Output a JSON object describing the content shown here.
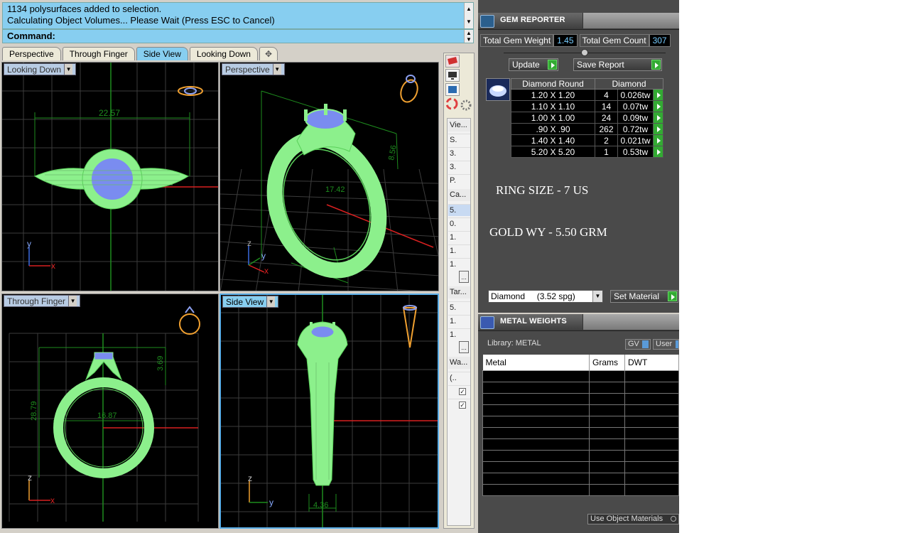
{
  "command": {
    "history_line1": "1134 polysurfaces added to selection.",
    "history_line2": "Calculating Object Volumes... Please Wait (Press ESC to Cancel)",
    "prompt": "Command:"
  },
  "tabs": [
    {
      "label": "Perspective"
    },
    {
      "label": "Through Finger"
    },
    {
      "label": "Side View"
    },
    {
      "label": "Looking Down"
    }
  ],
  "viewports": {
    "top_left": {
      "label": "Looking Down",
      "dimension": "22.57",
      "axis_x": "x",
      "axis_y": "y"
    },
    "top_right": {
      "label": "Perspective",
      "dimension_a": "17.42",
      "dimension_b": "8.56",
      "axis_x": "x",
      "axis_y": "y",
      "axis_z": "z"
    },
    "bottom_left": {
      "label": "Through Finger",
      "dimension_a": "16.87",
      "dimension_b": "28.79",
      "dimension_c": "3.69",
      "axis_x": "x",
      "axis_z": "z"
    },
    "bottom_right": {
      "label": "Side View",
      "dimension": "4.36",
      "axis_y": "y",
      "axis_z": "z"
    }
  },
  "side_panel": {
    "section1": "Vie...",
    "rows1": [
      "S.",
      "3.",
      "3.",
      "P."
    ],
    "section2": "Ca...",
    "rows2": [
      "5.",
      "0.",
      "1.",
      "1.",
      "1."
    ],
    "section3": "Tar...",
    "rows3": [
      "5.",
      "1.",
      "1."
    ],
    "section4": "Wa...",
    "rows4": [
      "(..",
      "",
      ""
    ],
    "more": "..."
  },
  "gem_reporter": {
    "title": "GEM REPORTER",
    "total_weight_label": "Total Gem Weight",
    "total_weight": "1.45",
    "total_count_label": "Total Gem Count",
    "total_count": "307",
    "update_label": "Update",
    "save_label": "Save Report",
    "table_header_1": "Diamond Round",
    "table_header_2": "Diamond",
    "rows": [
      {
        "size": "1.20 X 1.20",
        "count": "4",
        "weight": "0.026tw"
      },
      {
        "size": "1.10 X 1.10",
        "count": "14",
        "weight": "0.07tw"
      },
      {
        "size": "1.00 X 1.00",
        "count": "24",
        "weight": "0.09tw"
      },
      {
        "size": ".90 X .90",
        "count": "262",
        "weight": "0.72tw"
      },
      {
        "size": "1.40 X 1.40",
        "count": "2",
        "weight": "0.021tw"
      },
      {
        "size": "5.20 X 5.20",
        "count": "1",
        "weight": "0.53tw"
      }
    ],
    "note_ring_size": "RING SIZE - 7 US",
    "note_gold": "GOLD WY - 5.50 GRM",
    "material": "Diamond     (3.52 spg)",
    "set_material_label": "Set Material"
  },
  "metal_weights": {
    "title": "METAL WEIGHTS",
    "library": "Library: METAL",
    "gv": "GV",
    "user": "User",
    "columns": [
      "Metal",
      "Grams",
      "DWT"
    ],
    "use_object_materials": "Use Object Materials"
  },
  "colors": {
    "command_bg": "#87cef0",
    "model_green": "#8cf08c",
    "gem_blue": "#7a8cf0",
    "grid": "#4a4a4a",
    "axis_red": "#d82020",
    "axis_green": "#1e8c1e",
    "panel_bg": "#4a4a4a"
  }
}
